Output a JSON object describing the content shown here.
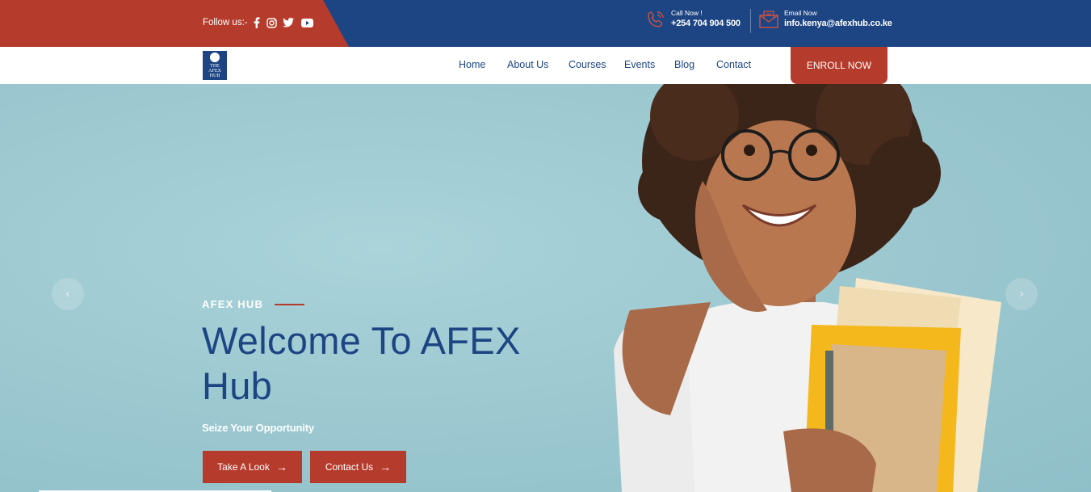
{
  "topbar": {
    "follow_label": "Follow us:-",
    "social_icons": [
      "facebook-icon",
      "instagram-icon",
      "twitter-icon",
      "youtube-icon"
    ],
    "call_label": "Call Now !",
    "call_value": "+254 704 904 500",
    "email_label": "Email Now",
    "email_value": "info.kenya@afexhub.co.ke"
  },
  "logo": {
    "line1": "THE",
    "line2": "AFEX",
    "line3": "HUB"
  },
  "nav": {
    "items": [
      "Home",
      "About Us",
      "Courses",
      "Events",
      "Blog",
      "Contact"
    ],
    "enroll_label": "ENROLL NOW"
  },
  "hero": {
    "eyebrow": "AFEX HUB",
    "headline": "Welcome To AFEX Hub",
    "subline": "Seize Your Opportunity",
    "primary_cta": "Take A Look",
    "secondary_cta": "Contact Us",
    "prev_arrow": "‹",
    "next_arrow": "›",
    "cta_arrow": "→"
  },
  "colors": {
    "brand_blue": "#1d4583",
    "brand_red": "#b53c2c",
    "hero_bg": "#9dc9d1"
  }
}
